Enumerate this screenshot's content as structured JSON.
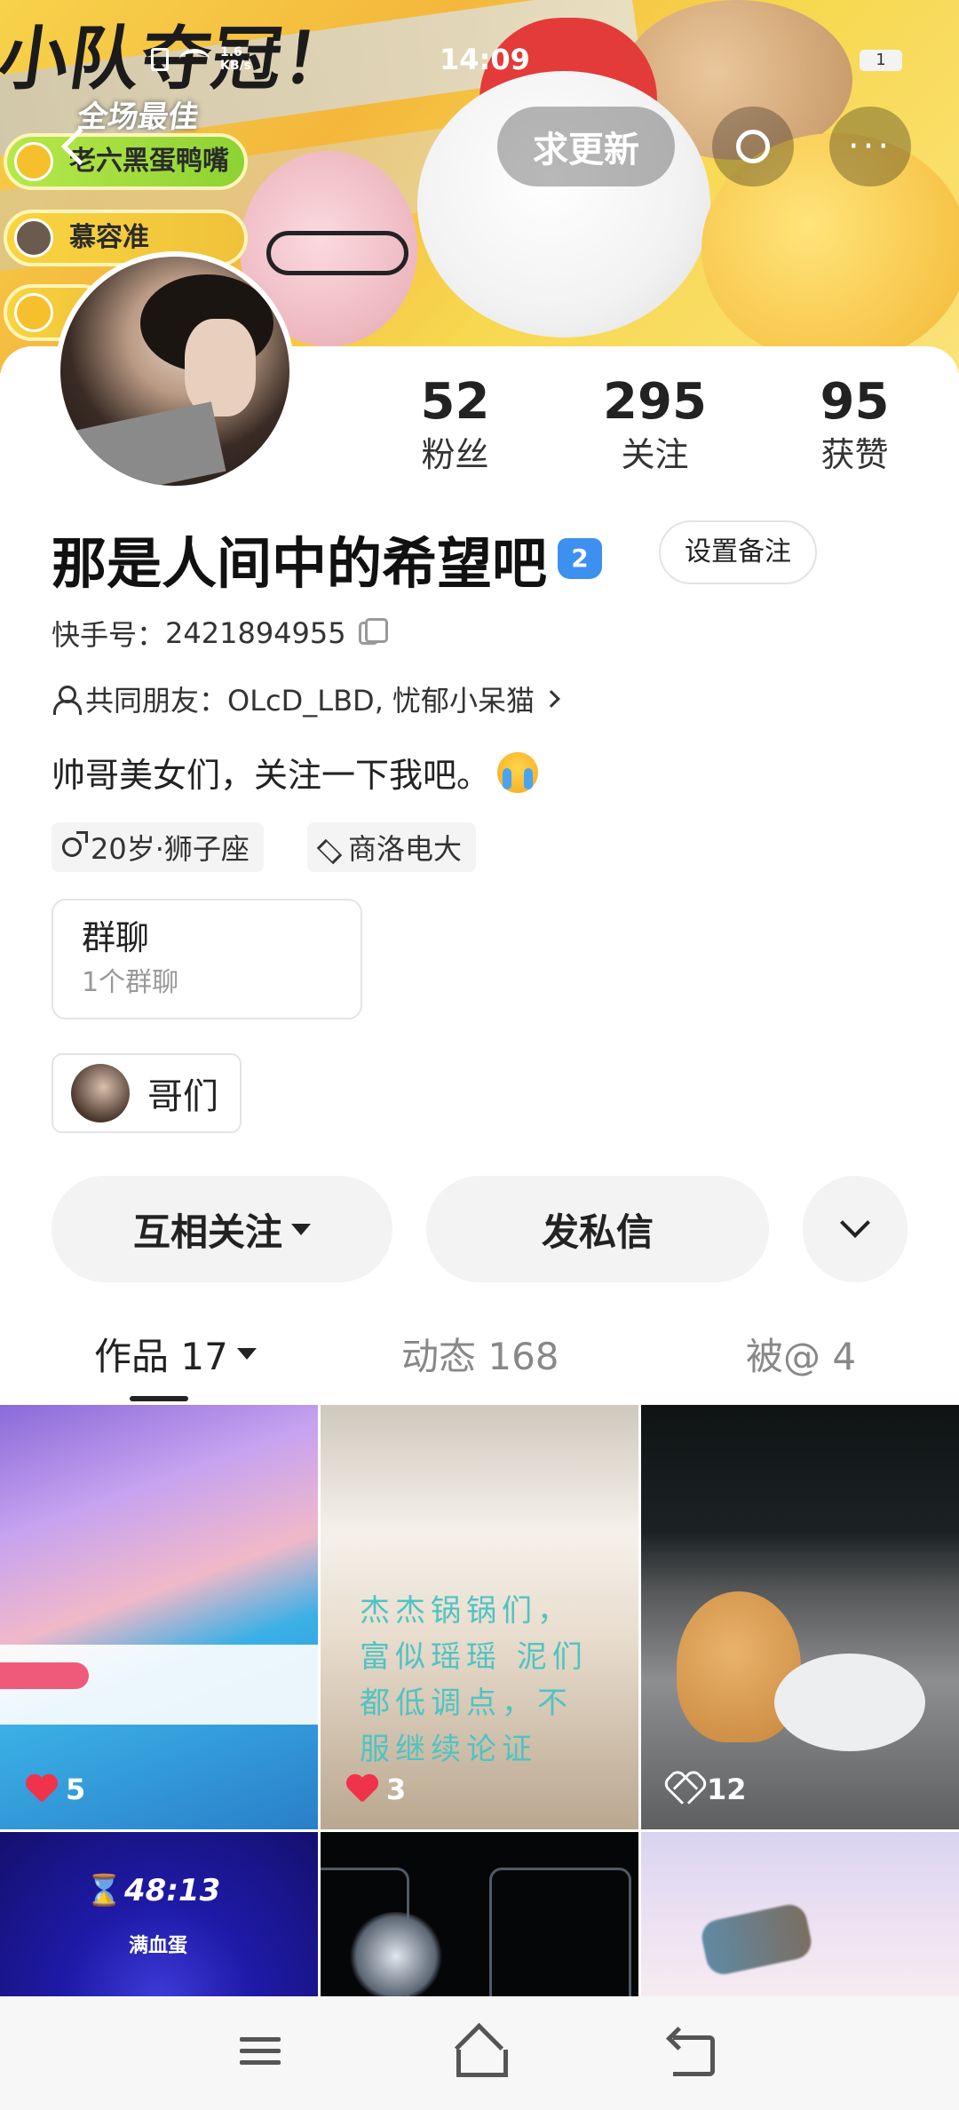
{
  "status_bar": {
    "time": "14:09",
    "net_speed_value": "1.6",
    "net_speed_unit": "KB/s",
    "battery": "1"
  },
  "banner": {
    "title_art": "小队夺冠！",
    "sub_art": "全场最佳",
    "ranks": [
      "老六黑蛋鸭嘴",
      "慕容准"
    ]
  },
  "top_actions": {
    "update_label": "求更新",
    "more_label": "···"
  },
  "profile": {
    "stats": [
      {
        "num": "52",
        "label": "粉丝"
      },
      {
        "num": "295",
        "label": "关注"
      },
      {
        "num": "95",
        "label": "获赞"
      }
    ],
    "name": "那是人间中的希望吧",
    "badge": "2",
    "remark_label": "设置备注",
    "ks_id_label": "快手号：",
    "ks_id": "2421894955",
    "mutual_friends_label": "共同朋友：",
    "mutual_friends": "OLcD_LBD, 忧郁小呆猫",
    "bio": "帅哥美女们，关注一下我吧。",
    "tag_age": "20岁·狮子座",
    "tag_school": "商洛电大",
    "group_title": "群聊",
    "group_sub": "1个群聊",
    "chip_label": "哥们"
  },
  "actions": {
    "follow_label": "互相关注",
    "message_label": "发私信"
  },
  "tabs": {
    "works": "作品 17",
    "dynamic": "动态 168",
    "mentioned": "被@ 4"
  },
  "grid": {
    "cell1_likes": "5",
    "cell2_likes": "3",
    "cell2_text": "杰杰锅锅们，富似瑶瑶 泥们都低调点，不服继续论证",
    "cell3_likes": "12",
    "cell4_timer": "48:13",
    "cell4_sub": "满血蛋"
  },
  "colors": {
    "accent_blue": "#3d8ff0",
    "heart_red": "#f0334a",
    "banner_yellow": "#f7d24a"
  },
  "icons": [
    "back-icon",
    "search-icon",
    "more-icon",
    "copy-icon",
    "person-icon",
    "chevron-right-icon",
    "male-icon",
    "graduation-icon",
    "caret-down-icon",
    "chevron-down-icon",
    "heart-icon",
    "menu-icon",
    "home-icon",
    "back-nav-icon"
  ]
}
